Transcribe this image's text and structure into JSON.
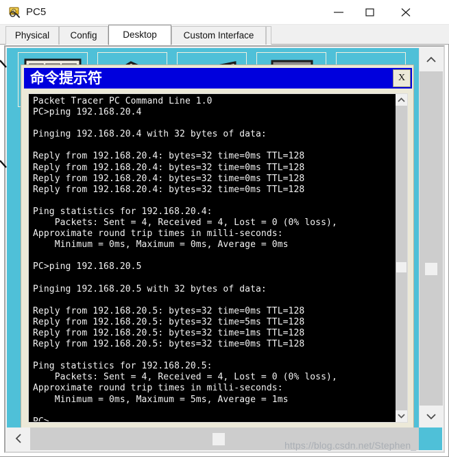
{
  "window": {
    "title": "PC5",
    "icon": "packet-tracer-icon",
    "controls": {
      "minimize": "minimize-icon",
      "maximize": "maximize-icon",
      "close": "close-icon"
    }
  },
  "tabs": [
    {
      "label": "Physical",
      "active": false
    },
    {
      "label": "Config",
      "active": false
    },
    {
      "label": "Desktop",
      "active": true
    },
    {
      "label": "Custom Interface",
      "active": false
    }
  ],
  "desktop": {
    "background_color": "#4fc0d8",
    "icons": [
      {
        "name": "ip-configuration-icon"
      },
      {
        "name": "dial-up-icon"
      },
      {
        "name": "terminal-icon"
      },
      {
        "name": "command-prompt-icon"
      },
      {
        "name": "web-browser-icon"
      }
    ]
  },
  "command_prompt": {
    "title": "命令提示符",
    "titlebar_color": "#0000dd",
    "close_label": "X",
    "terminal": {
      "background_color": "#000000",
      "text_color": "#f2f2f2",
      "lines": "Packet Tracer PC Command Line 1.0\nPC>ping 192.168.20.4\n\nPinging 192.168.20.4 with 32 bytes of data:\n\nReply from 192.168.20.4: bytes=32 time=0ms TTL=128\nReply from 192.168.20.4: bytes=32 time=0ms TTL=128\nReply from 192.168.20.4: bytes=32 time=0ms TTL=128\nReply from 192.168.20.4: bytes=32 time=0ms TTL=128\n\nPing statistics for 192.168.20.4:\n    Packets: Sent = 4, Received = 4, Lost = 0 (0% loss),\nApproximate round trip times in milli-seconds:\n    Minimum = 0ms, Maximum = 0ms, Average = 0ms\n\nPC>ping 192.168.20.5\n\nPinging 192.168.20.5 with 32 bytes of data:\n\nReply from 192.168.20.5: bytes=32 time=0ms TTL=128\nReply from 192.168.20.5: bytes=32 time=5ms TTL=128\nReply from 192.168.20.5: bytes=32 time=1ms TTL=128\nReply from 192.168.20.5: bytes=32 time=0ms TTL=128\n\nPing statistics for 192.168.20.5:\n    Packets: Sent = 4, Received = 4, Lost = 0 (0% loss),\nApproximate round trip times in milli-seconds:\n    Minimum = 0ms, Maximum = 5ms, Average = 1ms\n\nPC>",
      "sessions": [
        {
          "command": "PC>ping 192.168.20.4",
          "target": "192.168.20.4",
          "bytes": 32,
          "replies": [
            {
              "from": "192.168.20.4",
              "bytes": 32,
              "time": "0ms",
              "ttl": 128
            },
            {
              "from": "192.168.20.4",
              "bytes": 32,
              "time": "0ms",
              "ttl": 128
            },
            {
              "from": "192.168.20.4",
              "bytes": 32,
              "time": "0ms",
              "ttl": 128
            },
            {
              "from": "192.168.20.4",
              "bytes": 32,
              "time": "0ms",
              "ttl": 128
            }
          ],
          "statistics": {
            "sent": 4,
            "received": 4,
            "lost": 0,
            "loss_percent": "0%"
          },
          "round_trip": {
            "minimum": "0ms",
            "maximum": "0ms",
            "average": "0ms"
          }
        },
        {
          "command": "PC>ping 192.168.20.5",
          "target": "192.168.20.5",
          "bytes": 32,
          "replies": [
            {
              "from": "192.168.20.5",
              "bytes": 32,
              "time": "0ms",
              "ttl": 128
            },
            {
              "from": "192.168.20.5",
              "bytes": 32,
              "time": "5ms",
              "ttl": 128
            },
            {
              "from": "192.168.20.5",
              "bytes": 32,
              "time": "1ms",
              "ttl": 128
            },
            {
              "from": "192.168.20.5",
              "bytes": 32,
              "time": "0ms",
              "ttl": 128
            }
          ],
          "statistics": {
            "sent": 4,
            "received": 4,
            "lost": 0,
            "loss_percent": "0%"
          },
          "round_trip": {
            "minimum": "0ms",
            "maximum": "5ms",
            "average": "1ms"
          }
        }
      ],
      "banner": "Packet Tracer PC Command Line 1.0",
      "prompt": "PC>"
    }
  },
  "scrollbars": {
    "vertical": {
      "up": "chevron-up-icon",
      "down": "chevron-down-icon"
    },
    "horizontal": {
      "left": "chevron-left-icon",
      "right": "chevron-right-icon"
    }
  },
  "watermark": "https://blog.csdn.net/Stephen_"
}
